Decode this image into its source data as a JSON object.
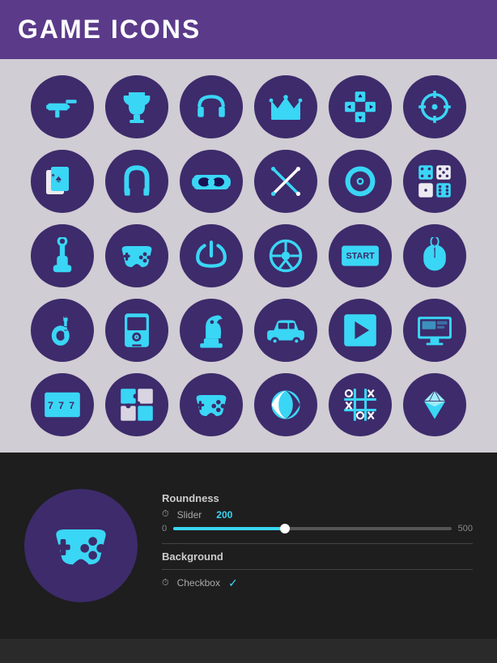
{
  "header": {
    "title": "GAME ICONS"
  },
  "icons": {
    "rows": [
      [
        "gun",
        "trophy",
        "headphones",
        "crown",
        "gamepad-dpad",
        "crosshair"
      ],
      [
        "cards",
        "horseshoe",
        "vr-headset",
        "swords",
        "disc",
        "dice"
      ],
      [
        "joystick",
        "controller",
        "power",
        "steering-wheel",
        "start-button",
        "mouse"
      ],
      [
        "guitar",
        "mp3-player",
        "chess-knight",
        "car",
        "play-button",
        "monitor"
      ],
      [
        "slots",
        "puzzle",
        "gamepad2",
        "beach-ball",
        "tic-tac-toe",
        "diamond"
      ]
    ]
  },
  "preview": {
    "icon": "gamepad"
  },
  "controls": {
    "roundness_label": "Roundness",
    "slider_label": "Slider",
    "slider_value": "200",
    "slider_min": "0",
    "slider_max": "500",
    "slider_percent": 40,
    "background_label": "Background",
    "checkbox_label": "Checkbox",
    "checkbox_checked": true
  }
}
